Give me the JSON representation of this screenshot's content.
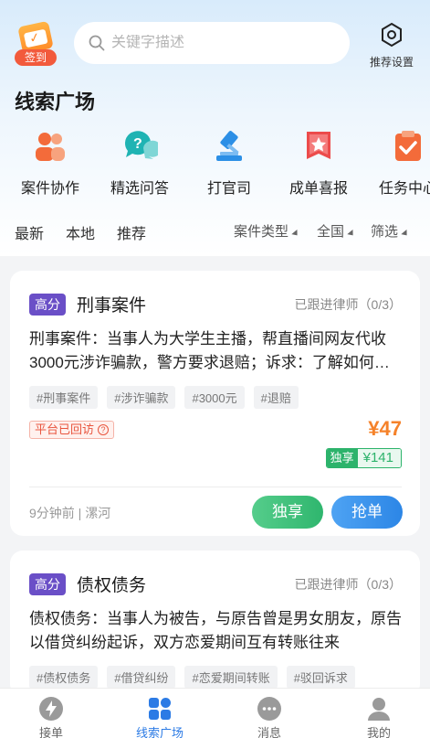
{
  "header": {
    "signin_label": "签到",
    "search_placeholder": "关键字描述",
    "settings_label": "推荐设置"
  },
  "page_title": "线索广场",
  "categories": [
    {
      "label": "案件协作",
      "icon": "people-icon",
      "color": "#f36b3a"
    },
    {
      "label": "精选问答",
      "icon": "question-chat-icon",
      "color": "#1fb3b3"
    },
    {
      "label": "打官司",
      "icon": "gavel-icon",
      "color": "#2c8fe6"
    },
    {
      "label": "成单喜报",
      "icon": "star-banner-icon",
      "color": "#ec4b4b"
    },
    {
      "label": "任务中心",
      "icon": "task-check-icon",
      "color": "#f36b3a"
    }
  ],
  "filters": {
    "latest": "最新",
    "local": "本地",
    "recommend": "推荐",
    "case_type": "案件类型",
    "region": "全国",
    "filter": "筛选"
  },
  "leads": [
    {
      "badge": "高分",
      "type": "刑事案件",
      "follow": "已跟进律师（0/3）",
      "desc": "刑事案件：当事人为大学生主播，帮直播间网友代收3000元涉诈骗款，警方要求退赔；诉求：了解如何处理",
      "tags": [
        "#刑事案件",
        "#涉诈骗款",
        "#3000元",
        "#退赔"
      ],
      "revisit": "平台已回访",
      "price": "¥47",
      "exclusive_label": "独享",
      "exclusive_price": "¥141",
      "meta": "9分钟前 | 漯河",
      "btn_exclusive": "独享",
      "btn_grab": "抢单"
    },
    {
      "badge": "高分",
      "type": "债权债务",
      "follow": "已跟进律师（0/3）",
      "desc": "债权债务：当事人为被告，与原告曾是男女朋友，原告以借贷纠纷起诉，双方恋爱期间互有转账往来",
      "tags": [
        "#债权债务",
        "#借贷纠纷",
        "#恋爱期间转账",
        "#驳回诉求"
      ]
    }
  ],
  "tabbar": [
    {
      "label": "接单",
      "icon": "lightning-icon",
      "active": false
    },
    {
      "label": "线索广场",
      "icon": "grid-icon",
      "active": true
    },
    {
      "label": "消息",
      "icon": "chat-icon",
      "active": false
    },
    {
      "label": "我的",
      "icon": "user-icon",
      "active": false
    }
  ],
  "colors": {
    "accent": "#2c7be5",
    "badge_purple": "#6a4fc7",
    "price_orange": "#f5822a",
    "exclusive_green": "#2cb36b"
  }
}
